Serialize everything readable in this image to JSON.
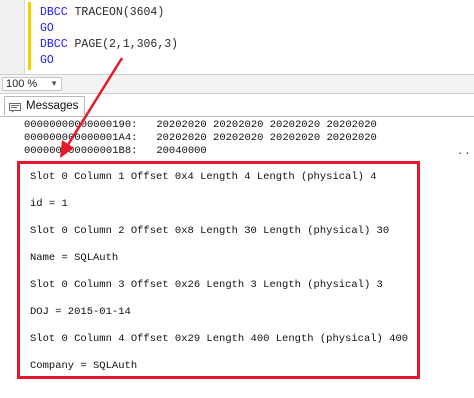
{
  "editor": {
    "lines": [
      {
        "keyword": "DBCC",
        "rest": " TRACEON(3604)"
      },
      {
        "keyword": "GO",
        "rest": ""
      },
      {
        "keyword": "DBCC",
        "rest": " PAGE(2,1,306,3)"
      },
      {
        "keyword": "GO",
        "rest": ""
      }
    ]
  },
  "zoom": {
    "value": "100 %"
  },
  "results": {
    "tab_label": "Messages",
    "dump_lines": [
      "00000000000000190:   20202020 20202020 20202020 20202020",
      "000000000000001A4:   20202020 20202020 20202020 20202020",
      "000000000000001B8:   20040000"
    ],
    "more_indicator": "...",
    "output_lines": [
      "Slot 0 Column 1 Offset 0x4 Length 4 Length (physical) 4",
      "id = 1",
      "Slot 0 Column 2 Offset 0x8 Length 30 Length (physical) 30",
      "Name = SQLAuth",
      "Slot 0 Column 3 Offset 0x26 Length 3 Length (physical) 3",
      "DOJ = 2015-01-14",
      "Slot 0 Column 4 Offset 0x29 Length 400 Length (physical) 400",
      "Company = SQLAuth"
    ]
  },
  "colors": {
    "keyword": "#1a1aff",
    "annotation": "#e5192b",
    "change_bar": "#f5d000"
  },
  "icons": {
    "tab_icon": "messages-icon",
    "zoom_caret": "chevron-down-icon"
  }
}
